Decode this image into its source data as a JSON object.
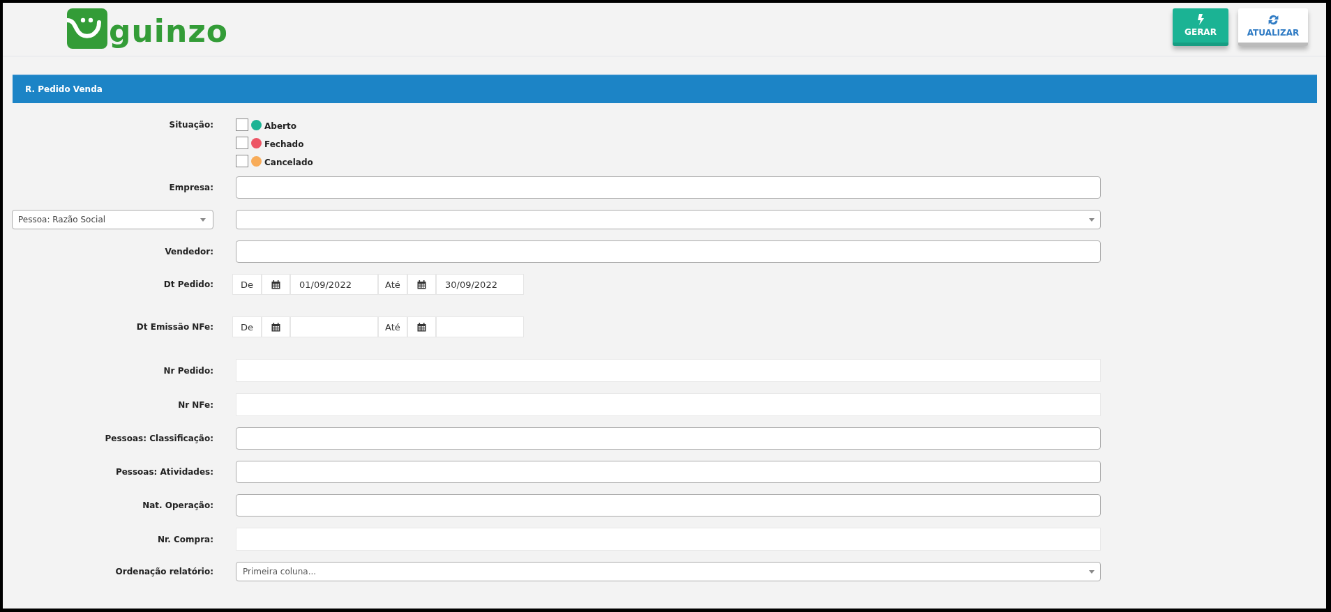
{
  "header": {
    "logo_text": "guinzo",
    "buttons": [
      {
        "label": "GERAR",
        "kind": "primary"
      },
      {
        "label": "ATUALIZAR",
        "kind": "secondary"
      }
    ]
  },
  "panel": {
    "title": "R. Pedido Venda"
  },
  "form": [
    {
      "kind": "checks",
      "label": "Situação:",
      "options": [
        {
          "label": "Aberto",
          "checked": false,
          "color": "#1bb394"
        },
        {
          "label": "Fechado",
          "checked": false,
          "color": "#ed5565"
        },
        {
          "label": "Cancelado",
          "checked": false,
          "color": "#f8ac59"
        }
      ]
    },
    {
      "kind": "input",
      "label": "Empresa:"
    },
    {
      "kind": "picker",
      "label": "Pessoa: Razão Social"
    },
    {
      "kind": "input",
      "label": "Vendedor:"
    },
    {
      "kind": "daterange",
      "label": "Dt Pedido:",
      "from_label": "De",
      "from": "01/09/2022",
      "to_label": "Até",
      "to": "30/09/2022"
    },
    {
      "kind": "daterange",
      "label": "Dt Emissão NFe:",
      "from_label": "De",
      "to_label": "Até"
    },
    {
      "kind": "flat",
      "label": "Nr Pedido:"
    },
    {
      "kind": "flat",
      "label": "Nr NFe:"
    },
    {
      "kind": "input",
      "label": "Pessoas: Classificação:"
    },
    {
      "kind": "input",
      "label": "Pessoas: Atividades:"
    },
    {
      "kind": "input",
      "label": "Nat. Operação:"
    },
    {
      "kind": "flat",
      "label": "Nr. Compra:"
    },
    {
      "kind": "select",
      "label": "Ordenação relatório:",
      "placeholder": "Primeira coluna..."
    }
  ]
}
